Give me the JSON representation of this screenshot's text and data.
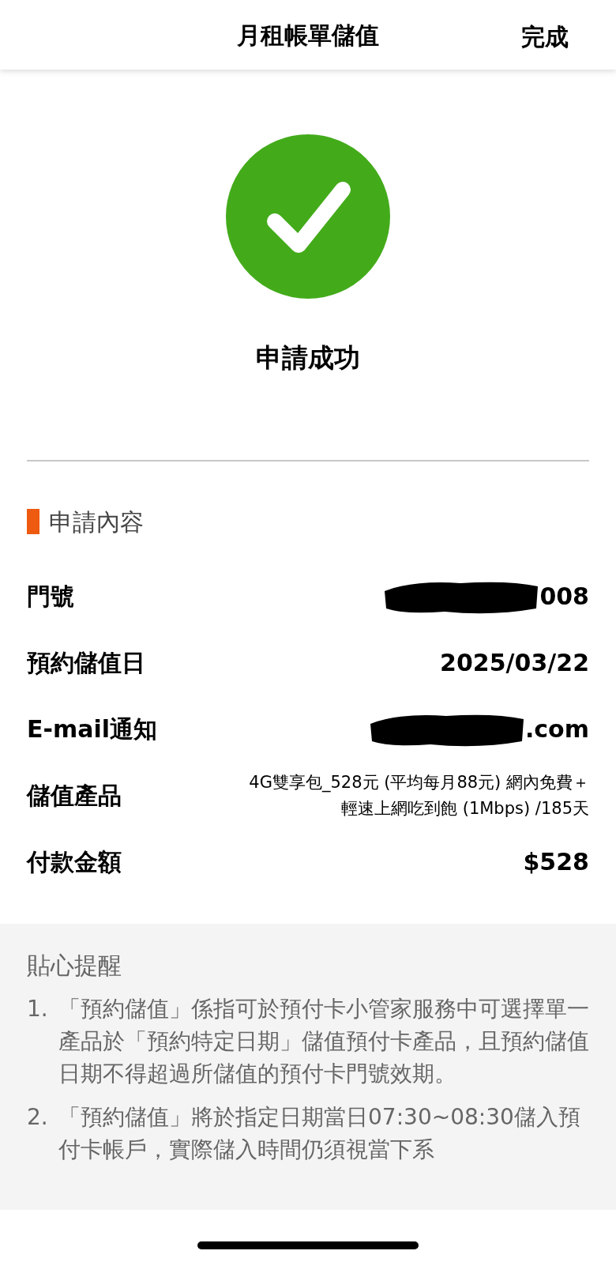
{
  "header": {
    "title": "月租帳單儲值",
    "done": "完成"
  },
  "status": {
    "kind": "success",
    "message": "申請成功"
  },
  "section": {
    "title": "申請內容"
  },
  "rows": [
    {
      "label": "門號",
      "value": "008",
      "redacted": true
    },
    {
      "label": "預約儲值日",
      "value": "2025/03/22",
      "redacted": false
    },
    {
      "label": "E-mail通知",
      "value": ".com",
      "redacted": true
    },
    {
      "label": "儲值產品",
      "value": "4G雙享包_528元 (平均每月88元) 網內免費＋輕速上網吃到飽 (1Mbps) /185天",
      "redacted": false,
      "kind": "small"
    },
    {
      "label": "付款金額",
      "value": "$528",
      "redacted": false
    }
  ],
  "tips": {
    "title": "貼心提醒",
    "items": [
      {
        "number": "1.",
        "text": "「預約儲值」係指可於預付卡小管家服務中可選擇單一產品於「預約特定日期」儲值預付卡產品，且預約儲值日期不得超過所儲值的預付卡門號效期。"
      },
      {
        "number": "2.",
        "text": "「預約儲值」將於指定日期當日07:30~08:30儲入預付卡帳戶，實際儲入時間仍須視當下系"
      }
    ]
  }
}
